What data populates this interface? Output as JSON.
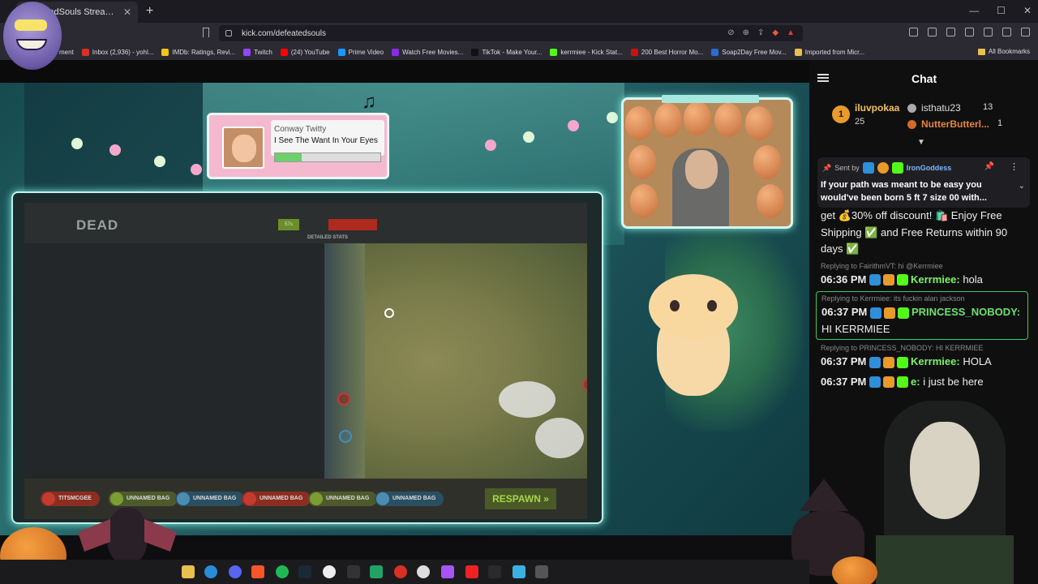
{
  "browser": {
    "tab_title": "DefeatedSouls Stream - Watc",
    "url": "kick.com/defeatedsouls",
    "bookmarks": [
      {
        "label": "ment",
        "color": "#5a5a5a"
      },
      {
        "label": "Inbox (2,936) - yohl...",
        "color": "#d93025"
      },
      {
        "label": "IMDb: Ratings, Revi...",
        "color": "#f5c518"
      },
      {
        "label": "Twitch",
        "color": "#9146ff"
      },
      {
        "label": "(24) YouTube",
        "color": "#ff0000"
      },
      {
        "label": "Prime Video",
        "color": "#1a98ff"
      },
      {
        "label": "Watch Free Movies...",
        "color": "#8a2be2"
      },
      {
        "label": "TikTok - Make Your...",
        "color": "#111111"
      },
      {
        "label": "kerrmiee - Kick Stat...",
        "color": "#53fc18"
      },
      {
        "label": "200 Best Horror Mo...",
        "color": "#cc1111"
      },
      {
        "label": "Soap2Day Free Mov...",
        "color": "#2a6bd6"
      },
      {
        "label": "Imported from Micr...",
        "color": "#e8c04e"
      }
    ],
    "all_bookmarks": "All Bookmarks"
  },
  "overlay": {
    "now_playing": {
      "artist": "Conway Twitty",
      "title": "I See The Want In Your Eyes",
      "progress": 0.25
    }
  },
  "game": {
    "status": "DEAD",
    "stat_green": "57s",
    "detailed_stats": "DETAILED STATS",
    "bags": [
      {
        "label": "TITSMCGEE",
        "color": "#8c2d22",
        "dot": "#c43b2f"
      },
      {
        "label": "UNNAMED BAG",
        "color": "#4e5a2c",
        "dot": "#7a9e34"
      },
      {
        "label": "UNNAMED BAG",
        "color": "#2b4f62",
        "dot": "#4a8db0"
      },
      {
        "label": "UNNAMED BAG",
        "color": "#8c2d22",
        "dot": "#c43b2f"
      },
      {
        "label": "UNNAMED BAG",
        "color": "#4e5a2c",
        "dot": "#7a9e34"
      },
      {
        "label": "UNNAMED BAG",
        "color": "#2b4f62",
        "dot": "#4a8db0"
      }
    ],
    "respawn": "RESPAWN"
  },
  "chat": {
    "title": "Chat",
    "leaderboard": {
      "first": {
        "rank": "1",
        "name": "iluvpokaa",
        "value": "25"
      },
      "second": {
        "name": "isthatu23",
        "value": "13"
      },
      "third": {
        "name": "NutterButterl...",
        "value": "1"
      }
    },
    "pinned": {
      "sent_by": "Sent by",
      "user": "IronGoddess",
      "text": "If your path was meant to be easy you would've been born 5 ft 7 size 00 with..."
    },
    "messages": [
      {
        "type": "cont",
        "text": "get 💰30% off discount! 🛍️ Enjoy Free Shipping ✅ and Free Returns within 90 days ✅"
      },
      {
        "reply": "Replying to FairithmVT: hi @Kerrmiee",
        "time": "06:36 PM",
        "user": "Kerrmiee:",
        "text": "hola",
        "user_class": "u-lime"
      },
      {
        "reply": "Replying to Kerrmiee: its fuckin alan jackson",
        "time": "06:37 PM",
        "user": "PRINCESS_NOBODY:",
        "text": "HI KERRMIEE",
        "user_class": "u-green",
        "highlight": true
      },
      {
        "reply": "Replying to PRINCESS_NOBODY: HI KERRMIEE",
        "time": "06:37 PM",
        "user": "Kerrmiee:",
        "text": "HOLA",
        "user_class": "u-lime"
      },
      {
        "time": "06:37 PM",
        "user": "e:",
        "text": "i just be here",
        "user_class": "u-lime"
      }
    ]
  },
  "colors": {
    "kick_green": "#53fc18",
    "accent_teal": "#bdf1ec",
    "chat_bg": "#0f0f10"
  }
}
